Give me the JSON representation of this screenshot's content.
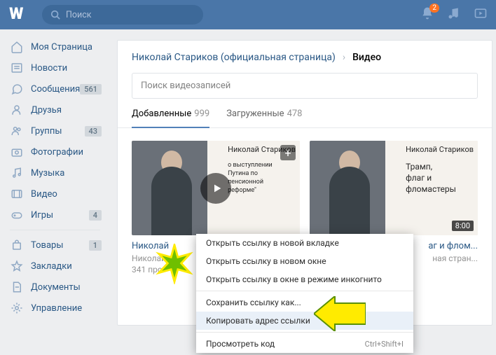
{
  "header": {
    "search_placeholder": "Поиск",
    "notification_badge": "2"
  },
  "sidebar": {
    "items": [
      {
        "label": "Моя Страница",
        "count": null
      },
      {
        "label": "Новости",
        "count": null
      },
      {
        "label": "Сообщения",
        "count": "561"
      },
      {
        "label": "Друзья",
        "count": null
      },
      {
        "label": "Группы",
        "count": "43"
      },
      {
        "label": "Фотографии",
        "count": null
      },
      {
        "label": "Музыка",
        "count": null
      },
      {
        "label": "Видео",
        "count": null
      },
      {
        "label": "Игры",
        "count": "4"
      }
    ],
    "items2": [
      {
        "label": "Товары",
        "count": "1"
      },
      {
        "label": "Закладки",
        "count": null
      },
      {
        "label": "Документы",
        "count": null
      },
      {
        "label": "Управление",
        "count": null
      }
    ]
  },
  "breadcrumb": {
    "parent": "Николай Стариков (официальная страница)",
    "current": "Видео"
  },
  "video_search_placeholder": "Поиск видеозаписей",
  "tabs": [
    {
      "label": "Добавленные",
      "count": "999"
    },
    {
      "label": "Загруженные",
      "count": "478"
    }
  ],
  "videos": [
    {
      "thumb_name": "Николай Стариков",
      "thumb_text": "о выступлении\nПутина по\nпенсионной\nреформе\"",
      "title": "Николай",
      "subtitle": "Николай",
      "views": "341 про"
    },
    {
      "thumb_name": "Николай Стариков",
      "thumb_text": "Трамп,\nфлаг и\nфломастеры",
      "duration": "8:00",
      "title": "аг и флом...",
      "subtitle": "ная стран..."
    }
  ],
  "context_menu": {
    "items": [
      "Открыть ссылку в новой вкладке",
      "Открыть ссылку в новом окне",
      "Открыть ссылку в окне в режиме инкогнито"
    ],
    "items2": [
      "Сохранить ссылку как...",
      "Копировать адрес ссылки"
    ],
    "items3_label": "Просмотреть код",
    "items3_shortcut": "Ctrl+Shift+I"
  }
}
